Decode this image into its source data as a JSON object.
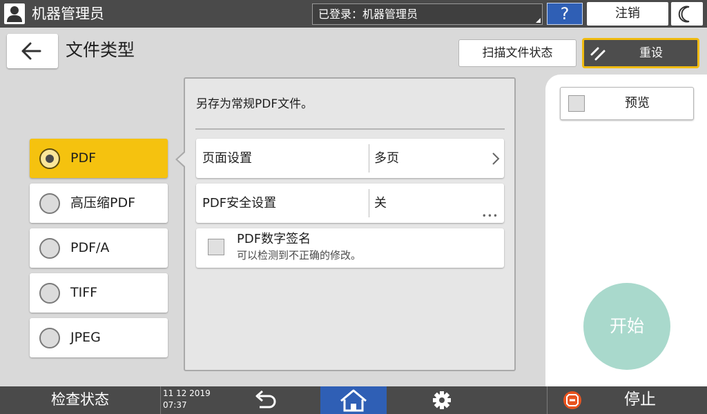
{
  "topbar": {
    "user_title": "机器管理员",
    "login_status": "已登录：机器管理员",
    "help_label": "?",
    "logout_label": "注销"
  },
  "header": {
    "page_title": "文件类型",
    "scan_status_label": "扫描文件状态",
    "reset_label": "重设"
  },
  "file_types": [
    {
      "label": "PDF",
      "selected": true
    },
    {
      "label": "高压缩PDF",
      "selected": false
    },
    {
      "label": "PDF/A",
      "selected": false
    },
    {
      "label": "TIFF",
      "selected": false
    },
    {
      "label": "JPEG",
      "selected": false
    }
  ],
  "panel": {
    "description": "另存为常规PDF文件。",
    "page_setting": {
      "label": "页面设置",
      "value": "多页"
    },
    "security_setting": {
      "label": "PDF安全设置",
      "value": "关"
    },
    "digital_signature": {
      "title": "PDF数字签名",
      "subtitle": "可以检测到不正确的修改。",
      "checked": false
    }
  },
  "right": {
    "preview_label": "预览",
    "preview_checked": false,
    "start_label": "开始"
  },
  "bottombar": {
    "status_check_label": "检查状态",
    "date": "11 12 2019",
    "time": "07:37",
    "stop_label": "停止"
  },
  "colors": {
    "selected_accent": "#f5c20f",
    "bar_bg": "#4a4a4a",
    "home_blue": "#2f5fb5",
    "start_green": "#a9d9cc",
    "reset_border": "#f0bb10"
  }
}
